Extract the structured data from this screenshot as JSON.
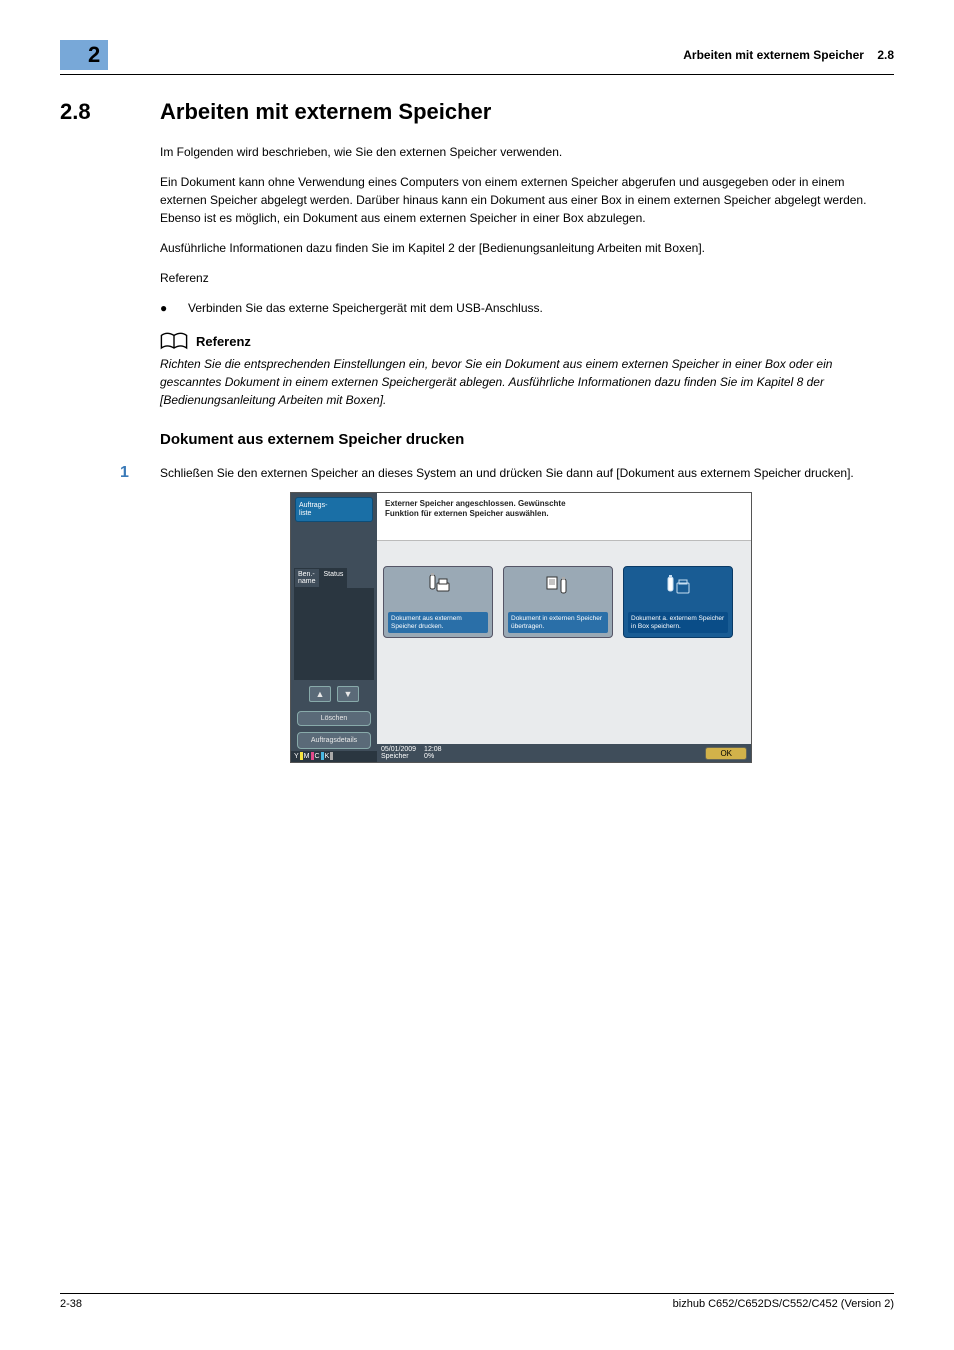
{
  "header": {
    "chapter": "2",
    "title": "Arbeiten mit externem Speicher",
    "ref": "2.8"
  },
  "section": {
    "num": "2.8",
    "title": "Arbeiten mit externem Speicher"
  },
  "intro": "Im Folgenden wird beschrieben, wie Sie den externen Speicher verwenden.",
  "para2": "Ein Dokument kann ohne Verwendung eines Computers von einem externen Speicher abgerufen und ausgegeben oder in einem externen Speicher abgelegt werden. Darüber hinaus kann ein Dokument aus einer Box in einem externen Speicher abgelegt werden. Ebenso ist es möglich, ein Dokument aus einem externen Speicher in einer Box abzulegen.",
  "para3": "Ausführliche Informationen dazu finden Sie im Kapitel 2 der [Bedienungsanleitung Arbeiten mit Boxen].",
  "ref_label": "Referenz",
  "bullet1": "Verbinden Sie das externe Speichergerät mit dem USB-Anschluss.",
  "refbox_label": "Referenz",
  "refbox_text": "Richten Sie die entsprechenden Einstellungen ein, bevor Sie ein Dokument aus einem externen Speicher in einer Box oder ein gescanntes Dokument in einem externen Speichergerät ablegen. Ausführliche Informationen dazu finden Sie im Kapitel 8 der [Bedienungsanleitung Arbeiten mit Boxen].",
  "sub_title": "Dokument aus externem Speicher drucken",
  "step1_num": "1",
  "step1_text": "Schließen Sie den externen Speicher an dieses System an und drücken Sie dann auf [Dokument aus externem Speicher drucken].",
  "panel": {
    "sidebar": {
      "jobs": "Auftrags-\nliste",
      "tab1": "Ben.-\nname",
      "tab2": "Status",
      "delete": "Löschen",
      "details": "Auftragsdetails",
      "y": "Y",
      "m": "M",
      "c": "C",
      "k": "K"
    },
    "main": {
      "headline": "Externer Speicher angeschlossen. Gewünschte\nFunktion für externen Speicher auswählen.",
      "func1": "Dokument aus externem Speicher drucken.",
      "func2": "Dokument in externen Speicher übertragen.",
      "func3": "Dokument a. externem Speicher in Box speichern."
    },
    "status": {
      "date": "05/01/2009",
      "time": "12:08",
      "mem_label": "Speicher",
      "mem_val": "0%",
      "ok": "OK"
    }
  },
  "footer": {
    "page": "2-38",
    "model": "bizhub C652/C652DS/C552/C452 (Version 2)"
  }
}
